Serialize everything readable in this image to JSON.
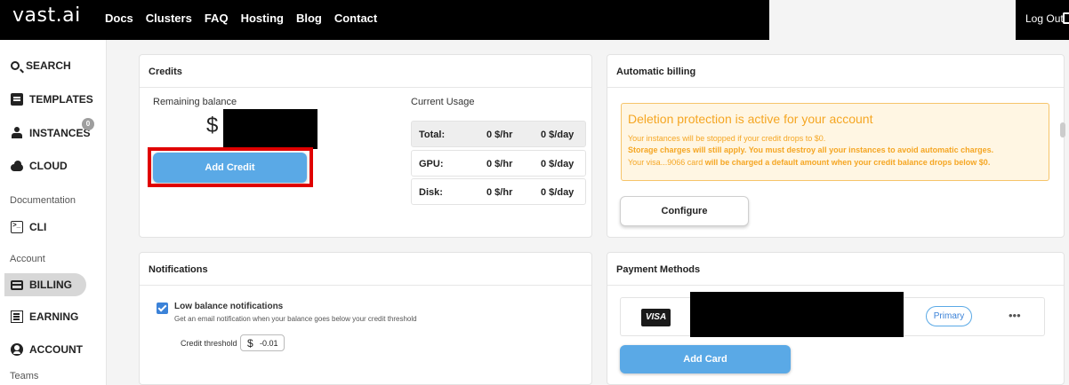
{
  "header": {
    "logo": "vast.ai",
    "nav": [
      "Docs",
      "Clusters",
      "FAQ",
      "Hosting",
      "Blog",
      "Contact"
    ],
    "logout": "Log Out"
  },
  "sidebar": {
    "items": [
      {
        "label": "SEARCH",
        "icon": "search-icon"
      },
      {
        "label": "TEMPLATES",
        "icon": "template-icon"
      },
      {
        "label": "INSTANCES",
        "icon": "instances-icon",
        "badge": "0"
      },
      {
        "label": "CLOUD",
        "icon": "cloud-icon"
      }
    ],
    "documentation_label": "Documentation",
    "cli_label": "CLI",
    "account_section_label": "Account",
    "account_items": [
      {
        "label": "BILLING",
        "icon": "credit-card-icon",
        "active": true
      },
      {
        "label": "EARNING",
        "icon": "earning-icon"
      },
      {
        "label": "ACCOUNT",
        "icon": "account-icon"
      }
    ],
    "teams_label": "Teams"
  },
  "credits": {
    "title": "Credits",
    "remaining_label": "Remaining balance",
    "currency": "$",
    "add_credit": "Add Credit",
    "current_usage_label": "Current Usage",
    "usage": [
      {
        "label": "Total:",
        "rate": "0 $/hr",
        "daily": "0 $/day"
      },
      {
        "label": "GPU:",
        "rate": "0 $/hr",
        "daily": "0 $/day"
      },
      {
        "label": "Disk:",
        "rate": "0 $/hr",
        "daily": "0 $/day"
      }
    ]
  },
  "billing": {
    "title": "Automatic billing",
    "warning_title": "Deletion protection is active for your account",
    "line1": "Your instances will be stopped if your credit drops to $0.",
    "line2": "Storage charges will still apply. You must destroy all your instances to avoid automatic charges.",
    "line3_prefix": "Your visa...9066 card",
    "line3_bold": "will be charged a default amount when your credit balance drops below $0.",
    "configure": "Configure"
  },
  "notifications": {
    "title": "Notifications",
    "checkbox_label": "Low balance notifications",
    "description": "Get an email notification when your balance goes below your credit threshold",
    "threshold_label": "Credit threshold",
    "threshold_currency": "$",
    "threshold_value": "-0.01",
    "checked": true
  },
  "payment": {
    "title": "Payment Methods",
    "card_brand": "VISA",
    "primary": "Primary",
    "more": "•••",
    "add_card": "Add Card"
  },
  "colors": {
    "accent": "#5aa9e6",
    "highlight": "#e00000",
    "warning": "#f5a623"
  }
}
